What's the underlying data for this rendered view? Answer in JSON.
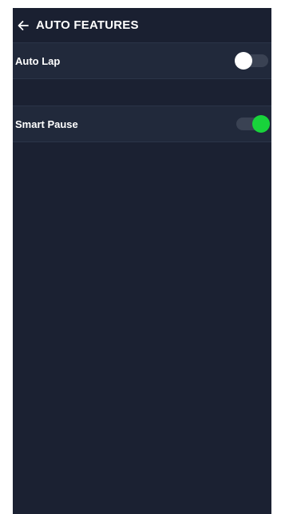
{
  "header": {
    "title": "AUTO FEATURES",
    "back_icon": "arrow-left-icon"
  },
  "settings": [
    {
      "label": "Auto Lap",
      "enabled": false
    },
    {
      "label": "Smart Pause",
      "enabled": true
    }
  ],
  "colors": {
    "background": "#1b2132",
    "row_background": "#21293b",
    "toggle_on": "#18d33b",
    "toggle_off_knob": "#ffffff",
    "toggle_track": "#3a4253"
  }
}
